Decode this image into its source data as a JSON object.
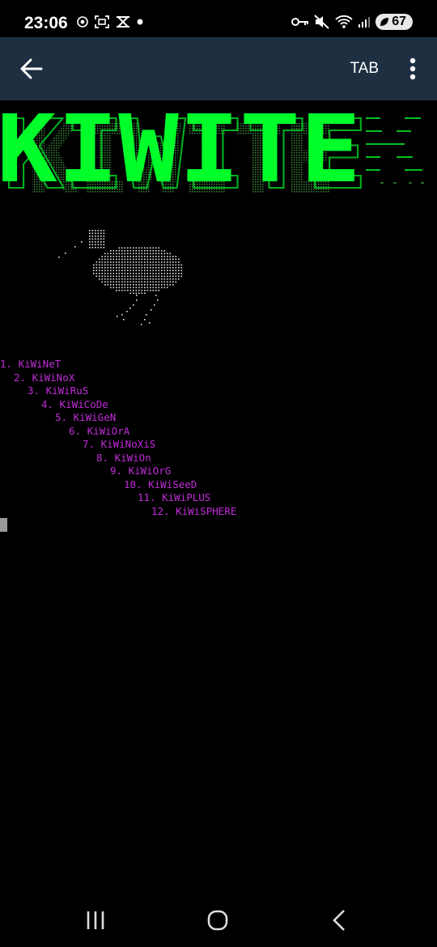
{
  "status_bar": {
    "time": "23:06",
    "battery": "67",
    "icons": [
      "settings-dot-icon",
      "screen-recorder-icon",
      "capcut-icon",
      "dot-icon",
      "vpn-key-icon",
      "mute-icon",
      "wifi-icon",
      "signal-icon",
      "battery-saver-icon"
    ]
  },
  "app_bar": {
    "tab_label": "TAB",
    "icons": [
      "back-arrow-icon",
      "more-vert-icon"
    ]
  },
  "terminal": {
    "banner_text": "KIWITE",
    "banner_color": "#00ff2a",
    "menu_color": "#c02cd8",
    "menu_items": [
      "1. KiWiNeT",
      "2. KiWiNoX",
      "3. KiWiRuS",
      "4. KiWiCoDe",
      "5. KiWiGeN",
      "6. KiWiOrA",
      "7. KiWiNoXiS",
      "8. KiWiOn",
      "9. KiWiOrG",
      "10. KiWiSeeD",
      "11. KiWiPLUS",
      "12. KiWiSPHERE"
    ]
  },
  "nav_bar": {
    "icons": [
      "recent-apps-icon",
      "home-icon",
      "nav-back-icon"
    ]
  }
}
